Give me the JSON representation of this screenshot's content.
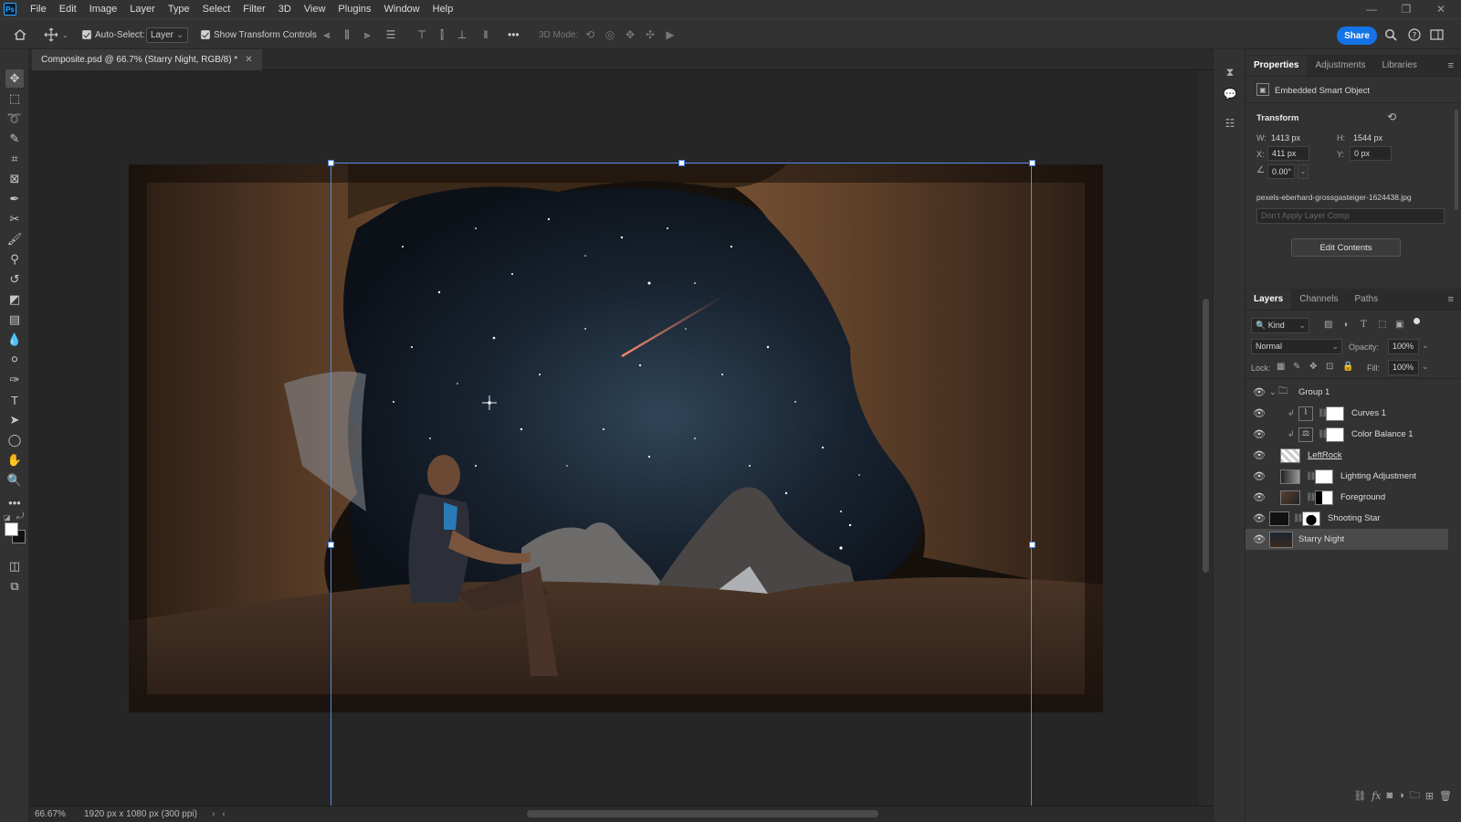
{
  "app": {
    "logo": "Ps"
  },
  "menu": [
    "File",
    "Edit",
    "Image",
    "Layer",
    "Type",
    "Select",
    "Filter",
    "3D",
    "View",
    "Plugins",
    "Window",
    "Help"
  ],
  "window_controls": {
    "minimize": "—",
    "restore": "❐",
    "close": "✕"
  },
  "options": {
    "auto_select_label": "Auto-Select:",
    "auto_select_target": "Layer",
    "show_transform_label": "Show Transform Controls",
    "more": "•••",
    "mode_3d": "3D Mode:",
    "share_label": "Share"
  },
  "document": {
    "tab_title": "Composite.psd @ 66.7% (Starry Night, RGB/8) *",
    "zoom": "66.67%",
    "doc_info": "1920 px x 1080 px (300 ppi)"
  },
  "properties_panel": {
    "tabs": [
      "Properties",
      "Adjustments",
      "Libraries"
    ],
    "object_type": "Embedded Smart Object",
    "section_title": "Transform",
    "w_label": "W:",
    "w_value": "1413 px",
    "h_label": "H:",
    "h_value": "1544 px",
    "x_label": "X:",
    "x_value": "411 px",
    "y_label": "Y:",
    "y_value": "0 px",
    "angle_value": "0.00°",
    "filename": "pexels-eberhard-grossgasteiger-1624438.jpg",
    "layer_comp_placeholder": "Don't Apply Layer Comp",
    "edit_contents_label": "Edit Contents"
  },
  "layers_panel": {
    "tabs": [
      "Layers",
      "Channels",
      "Paths"
    ],
    "filter_kind": "Kind",
    "blend_mode": "Normal",
    "opacity_label": "Opacity:",
    "opacity_value": "100%",
    "lock_label": "Lock:",
    "fill_label": "Fill:",
    "fill_value": "100%",
    "layers": [
      {
        "name": "Group 1"
      },
      {
        "name": "Curves 1"
      },
      {
        "name": "Color Balance 1"
      },
      {
        "name": "LeftRock"
      },
      {
        "name": "Lighting Adjustment"
      },
      {
        "name": "Foreground"
      },
      {
        "name": "Shooting Star"
      },
      {
        "name": "Starry Night"
      }
    ]
  }
}
